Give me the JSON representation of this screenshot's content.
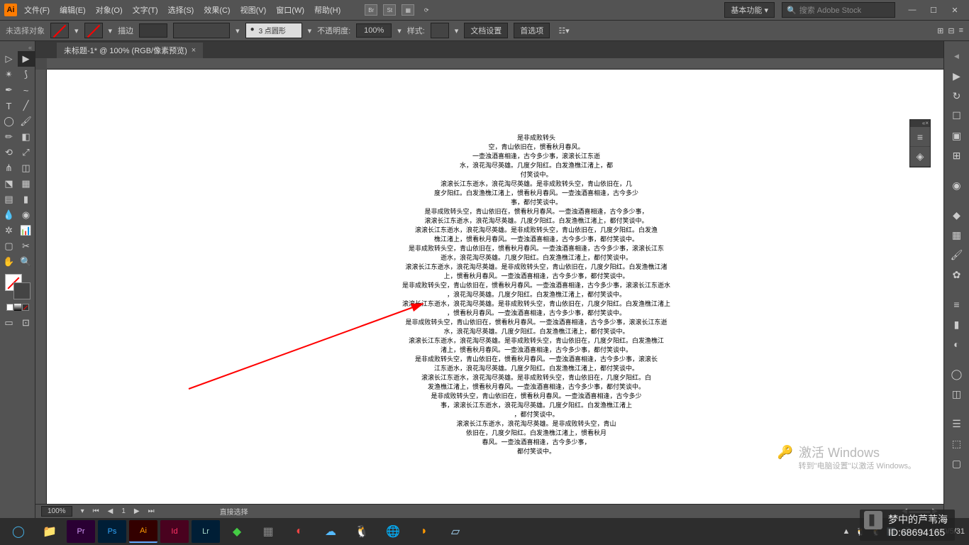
{
  "menu": {
    "items": [
      "文件(F)",
      "编辑(E)",
      "对象(O)",
      "文字(T)",
      "选择(S)",
      "效果(C)",
      "视图(V)",
      "窗口(W)",
      "帮助(H)"
    ],
    "essentials": "基本功能",
    "search_placeholder": "搜索 Adobe Stock"
  },
  "opt": {
    "no_selection": "未选择对象",
    "stroke_lbl": "描边",
    "stroke_val": "",
    "pt_val": "3 点圆形",
    "opacity_lbl": "不透明度:",
    "opacity_val": "100%",
    "style_lbl": "样式:",
    "doc_setup": "文档设置",
    "prefs": "首选项"
  },
  "tab": {
    "title": "未标题-1* @ 100% (RGB/像素预览)"
  },
  "status": {
    "zoom": "100%",
    "page": "1",
    "tool": "直接选择"
  },
  "watermark": {
    "title": "激活 Windows",
    "sub": "转到\"电脑设置\"以激活 Windows。"
  },
  "brand": {
    "l1": "梦中的芦苇海",
    "l2": "ID:68694165"
  },
  "taskbar": {
    "time": "2020/5/31"
  },
  "poem": [
    "是非成败转头",
    "空，青山依旧在，惯看秋月春风。",
    "一壶浊酒喜相逢，古今多少事，滚滚长江东逝",
    "水，浪花淘尽英雄。几度夕阳红。白发渔樵江渚上，都",
    "付笑谈中。",
    "滚滚长江东逝水，浪花淘尽英雄。是非成败转头空，青山依旧在，几",
    "度夕阳红。白发渔樵江渚上，惯看秋月春风。一壶浊酒喜相逢，古今多少",
    "事，都付笑谈中。",
    "是非成败转头空，青山依旧在，惯看秋月春风。一壶浊酒喜相逢，古今多少事，",
    "滚滚长江东逝水，浪花淘尽英雄。几度夕阳红。白发渔樵江渚上，都付笑谈中。",
    "滚滚长江东逝水，浪花淘尽英雄。是非成败转头空，青山依旧在，几度夕阳红。白发渔",
    "樵江渚上，惯看秋月春风。一壶浊酒喜相逢，古今多少事，都付笑谈中。",
    "是非成败转头空，青山依旧在，惯看秋月春风。一壶浊酒喜相逢，古今多少事，滚滚长江东",
    "逝水，浪花淘尽英雄。几度夕阳红。白发渔樵江渚上，都付笑谈中。",
    "滚滚长江东逝水，浪花淘尽英雄。是非成败转头空，青山依旧在，几度夕阳红。白发渔樵江渚",
    "上，惯看秋月春风。一壶浊酒喜相逢，古今多少事，都付笑谈中。",
    "是非成败转头空，青山依旧在，惯看秋月春风。一壶浊酒喜相逢，古今多少事，滚滚长江东逝水",
    "，浪花淘尽英雄。几度夕阳红。白发渔樵江渚上，都付笑谈中。",
    "滚滚长江东逝水，浪花淘尽英雄。是非成败转头空，青山依旧在，几度夕阳红。白发渔樵江渚上",
    "，惯看秋月春风。一壶浊酒喜相逢，古今多少事，都付笑谈中。",
    "是非成败转头空，青山依旧在，惯看秋月春风。一壶浊酒喜相逢，古今多少事，滚滚长江东逝",
    "水，浪花淘尽英雄。几度夕阳红。白发渔樵江渚上，都付笑谈中。",
    "滚滚长江东逝水，浪花淘尽英雄。是非成败转头空，青山依旧在，几度夕阳红。白发渔樵江",
    "渚上，惯看秋月春风。一壶浊酒喜相逢，古今多少事，都付笑谈中。",
    "是非成败转头空，青山依旧在，惯看秋月春风。一壶浊酒喜相逢，古今多少事，滚滚长",
    "江东逝水，浪花淘尽英雄。几度夕阳红。白发渔樵江渚上，都付笑谈中。",
    "滚滚长江东逝水，浪花淘尽英雄。是非成败转头空，青山依旧在，几度夕阳红。白",
    "发渔樵江渚上，惯看秋月春风。一壶浊酒喜相逢，古今多少事，都付笑谈中。",
    "是非成败转头空，青山依旧在，惯看秋月春风。一壶浊酒喜相逢，古今多少",
    "事，滚滚长江东逝水，浪花淘尽英雄。几度夕阳红。白发渔樵江渚上",
    "，都付笑谈中。",
    "滚滚长江东逝水，浪花淘尽英雄。是非成败转头空，青山",
    "依旧在，几度夕阳红。白发渔樵江渚上，惯看秋月",
    "春风。一壶浊酒喜相逢，古今多少事，",
    "都付笑谈中。"
  ]
}
